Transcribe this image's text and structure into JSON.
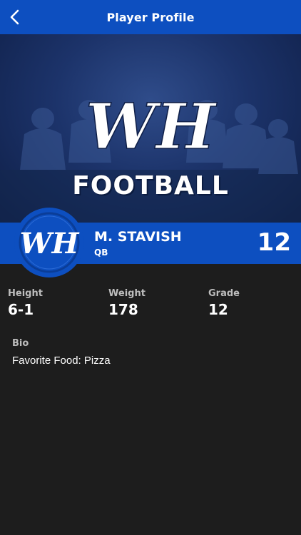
{
  "nav": {
    "title": "Player Profile",
    "back_icon": "chevron-left-icon"
  },
  "hero": {
    "logo_text": "WH",
    "word": "FOOTBALL"
  },
  "player": {
    "name": "M. STAVISH",
    "position": "QB",
    "number": "12",
    "avatar_logo_text": "WH"
  },
  "stats": [
    {
      "label": "Height",
      "value": "6-1"
    },
    {
      "label": "Weight",
      "value": "178"
    },
    {
      "label": "Grade",
      "value": "12"
    }
  ],
  "bio": {
    "label": "Bio",
    "text": "Favorite Food: Pizza"
  },
  "colors": {
    "brand_blue": "#0d4fc0",
    "background": "#1d1d1d",
    "label_gray": "#bdbdbd"
  }
}
